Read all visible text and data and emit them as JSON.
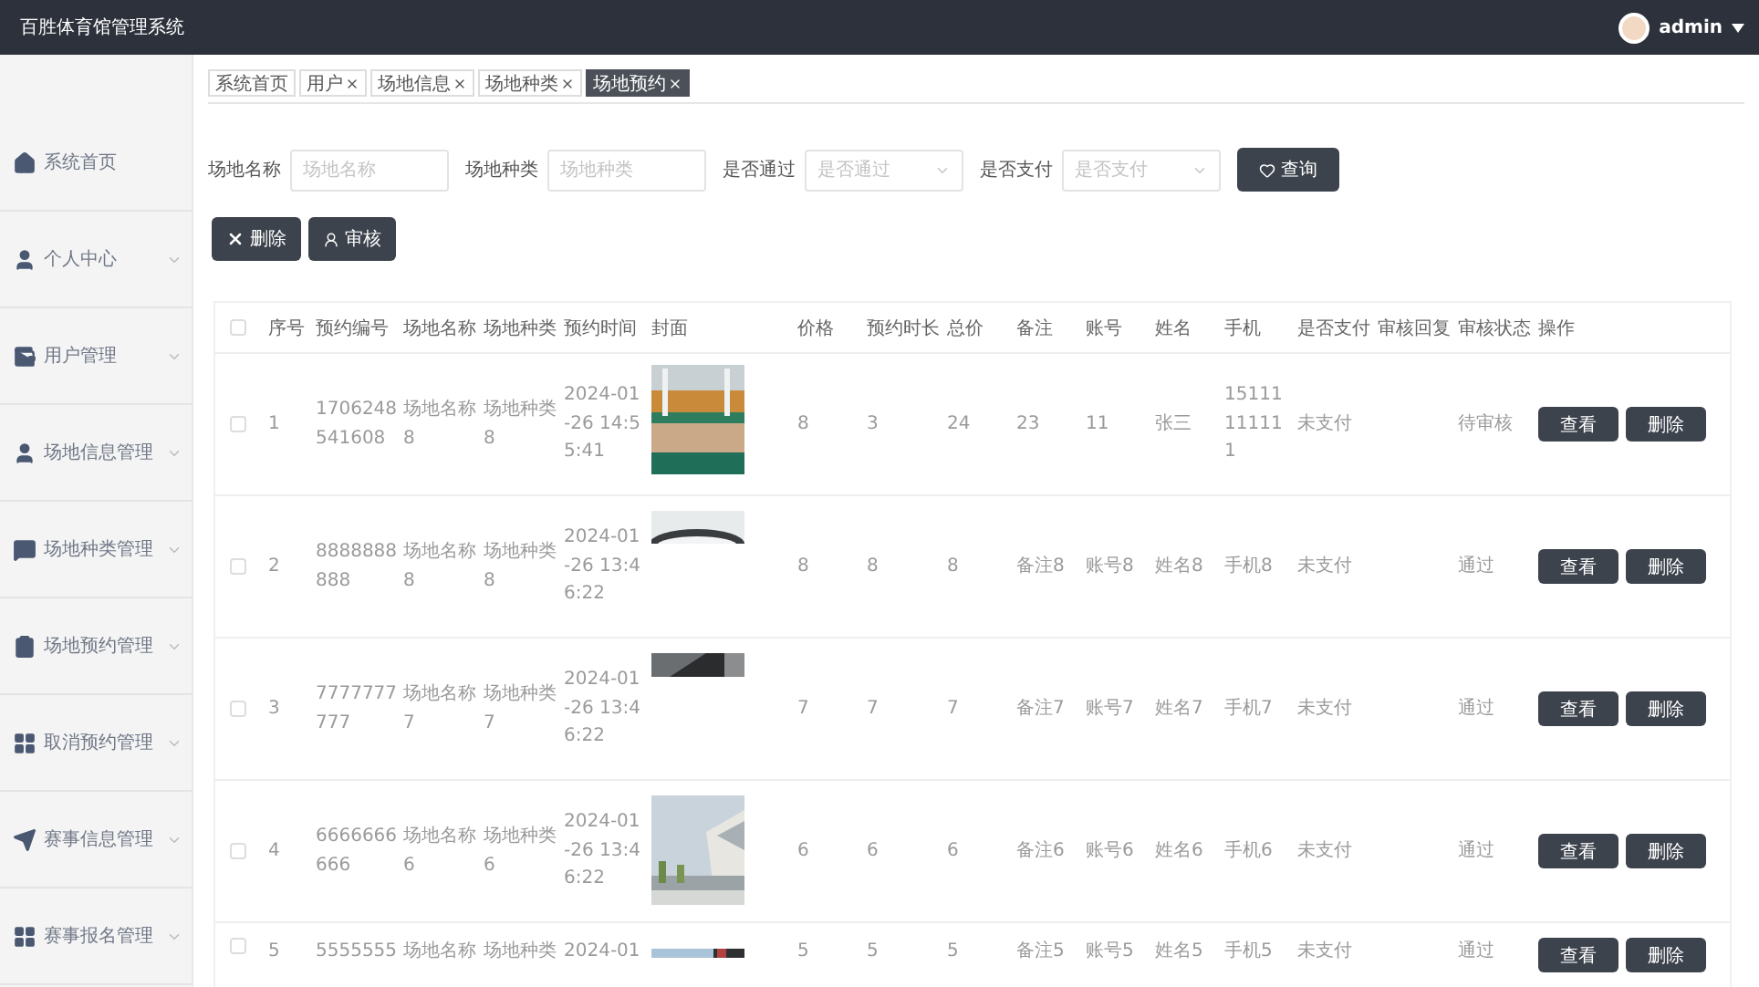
{
  "header": {
    "title": "百胜体育馆管理系统",
    "user": "admin"
  },
  "sidebar": {
    "items": [
      {
        "label": "系统首页",
        "expandable": false
      },
      {
        "label": "个人中心",
        "expandable": true
      },
      {
        "label": "用户管理",
        "expandable": true
      },
      {
        "label": "场地信息管理",
        "expandable": true
      },
      {
        "label": "场地种类管理",
        "expandable": true
      },
      {
        "label": "场地预约管理",
        "expandable": true
      },
      {
        "label": "取消预约管理",
        "expandable": true
      },
      {
        "label": "赛事信息管理",
        "expandable": true
      },
      {
        "label": "赛事报名管理",
        "expandable": true
      }
    ]
  },
  "tabs": [
    {
      "label": "系统首页",
      "closable": false,
      "selected": false
    },
    {
      "label": "用户",
      "closable": true,
      "selected": false
    },
    {
      "label": "场地信息",
      "closable": true,
      "selected": false
    },
    {
      "label": "场地种类",
      "closable": true,
      "selected": false
    },
    {
      "label": "场地预约",
      "closable": true,
      "selected": true
    }
  ],
  "filters": [
    {
      "kind": "input",
      "label": "场地名称",
      "placeholder": "场地名称"
    },
    {
      "kind": "input",
      "label": "场地种类",
      "placeholder": "场地种类"
    },
    {
      "kind": "select",
      "label": "是否通过",
      "placeholder": "是否通过"
    },
    {
      "kind": "select",
      "label": "是否支付",
      "placeholder": "是否支付"
    }
  ],
  "search_button": "查询",
  "toolbar": [
    {
      "kind": "delete",
      "label": "删除"
    },
    {
      "kind": "audit",
      "label": "审核"
    }
  ],
  "table": {
    "all_selected": false,
    "columns": [
      "序号",
      "预约编号",
      "场地名称",
      "场地种类",
      "预约时间",
      "封面",
      "价格",
      "预约时长",
      "总价",
      "备注",
      "账号",
      "姓名",
      "手机",
      "是否支付",
      "审核回复",
      "审核状态",
      "操作"
    ],
    "rows": [
      {
        "selected": false,
        "cells": [
          "1",
          "1706248541608",
          "场地名称8",
          "场地种类8",
          "2024-01-26 14:55:41",
          null,
          "8",
          "3",
          "24",
          "23",
          "11",
          "张三",
          "15111111111",
          "未支付",
          "",
          "待审核"
        ],
        "actions": [
          "查看",
          "删除"
        ]
      },
      {
        "selected": false,
        "cells": [
          "2",
          "8888888888",
          "场地名称8",
          "场地种类8",
          "2024-01-26 13:46:22",
          null,
          "8",
          "8",
          "8",
          "备注8",
          "账号8",
          "姓名8",
          "手机8",
          "未支付",
          "",
          "通过"
        ],
        "actions": [
          "查看",
          "删除"
        ]
      },
      {
        "selected": false,
        "cells": [
          "3",
          "7777777777",
          "场地名称7",
          "场地种类7",
          "2024-01-26 13:46:22",
          null,
          "7",
          "7",
          "7",
          "备注7",
          "账号7",
          "姓名7",
          "手机7",
          "未支付",
          "",
          "通过"
        ],
        "actions": [
          "查看",
          "删除"
        ]
      },
      {
        "selected": false,
        "cells": [
          "4",
          "6666666666",
          "场地名称6",
          "场地种类6",
          "2024-01-26 13:46:22",
          null,
          "6",
          "6",
          "6",
          "备注6",
          "账号6",
          "姓名6",
          "手机6",
          "未支付",
          "",
          "通过"
        ],
        "actions": [
          "查看",
          "删除"
        ]
      },
      {
        "selected": false,
        "cells": [
          "5",
          "5555555",
          "场地名称",
          "场地种类",
          "2024-01",
          null,
          "5",
          "5",
          "5",
          "备注5",
          "账号5",
          "姓名5",
          "手机5",
          "未支付",
          "",
          "通过"
        ],
        "actions": [
          "查看",
          "删除"
        ]
      }
    ]
  }
}
